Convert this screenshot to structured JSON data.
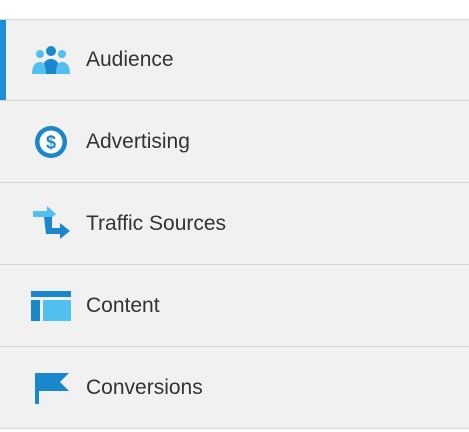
{
  "colors": {
    "accent": "#1e8fd6",
    "icon_blue": "#1a87cc",
    "icon_light": "#51c0ef",
    "item_bg": "#f1f1f1",
    "divider": "#d6d6d6",
    "text": "#333333"
  },
  "nav": {
    "items": [
      {
        "label": "Audience",
        "icon": "audience-icon",
        "active": true
      },
      {
        "label": "Advertising",
        "icon": "dollar-icon",
        "active": false
      },
      {
        "label": "Traffic Sources",
        "icon": "arrows-icon",
        "active": false
      },
      {
        "label": "Content",
        "icon": "content-icon",
        "active": false
      },
      {
        "label": "Conversions",
        "icon": "flag-icon",
        "active": false
      }
    ]
  }
}
